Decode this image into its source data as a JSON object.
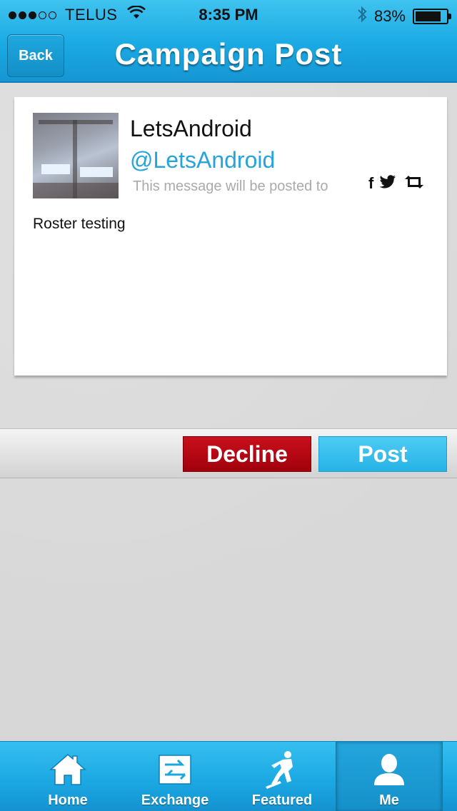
{
  "status_bar": {
    "carrier": "TELUS",
    "time": "8:35 PM",
    "battery": "83%",
    "battery_level": 0.83
  },
  "nav": {
    "back_label": "Back",
    "title": "Campaign Post"
  },
  "post": {
    "user_name": "LetsAndroid",
    "user_handle": "@LetsAndroid",
    "posted_to_text": "This message will be posted to",
    "share_icons": [
      "facebook-icon",
      "twitter-icon",
      "retweet-icon"
    ],
    "message": "Roster testing"
  },
  "actions": {
    "decline_label": "Decline",
    "post_label": "Post",
    "decline_color": "#b80813",
    "post_color": "#35bdeb"
  },
  "tabs": [
    {
      "label": "Home",
      "icon": "home-icon",
      "active": false
    },
    {
      "label": "Exchange",
      "icon": "exchange-icon",
      "active": false
    },
    {
      "label": "Featured",
      "icon": "hockey-player-icon",
      "active": false
    },
    {
      "label": "Me",
      "icon": "person-icon",
      "active": true
    }
  ],
  "colors": {
    "accent": "#1aa9e3",
    "handle": "#27a3db"
  }
}
